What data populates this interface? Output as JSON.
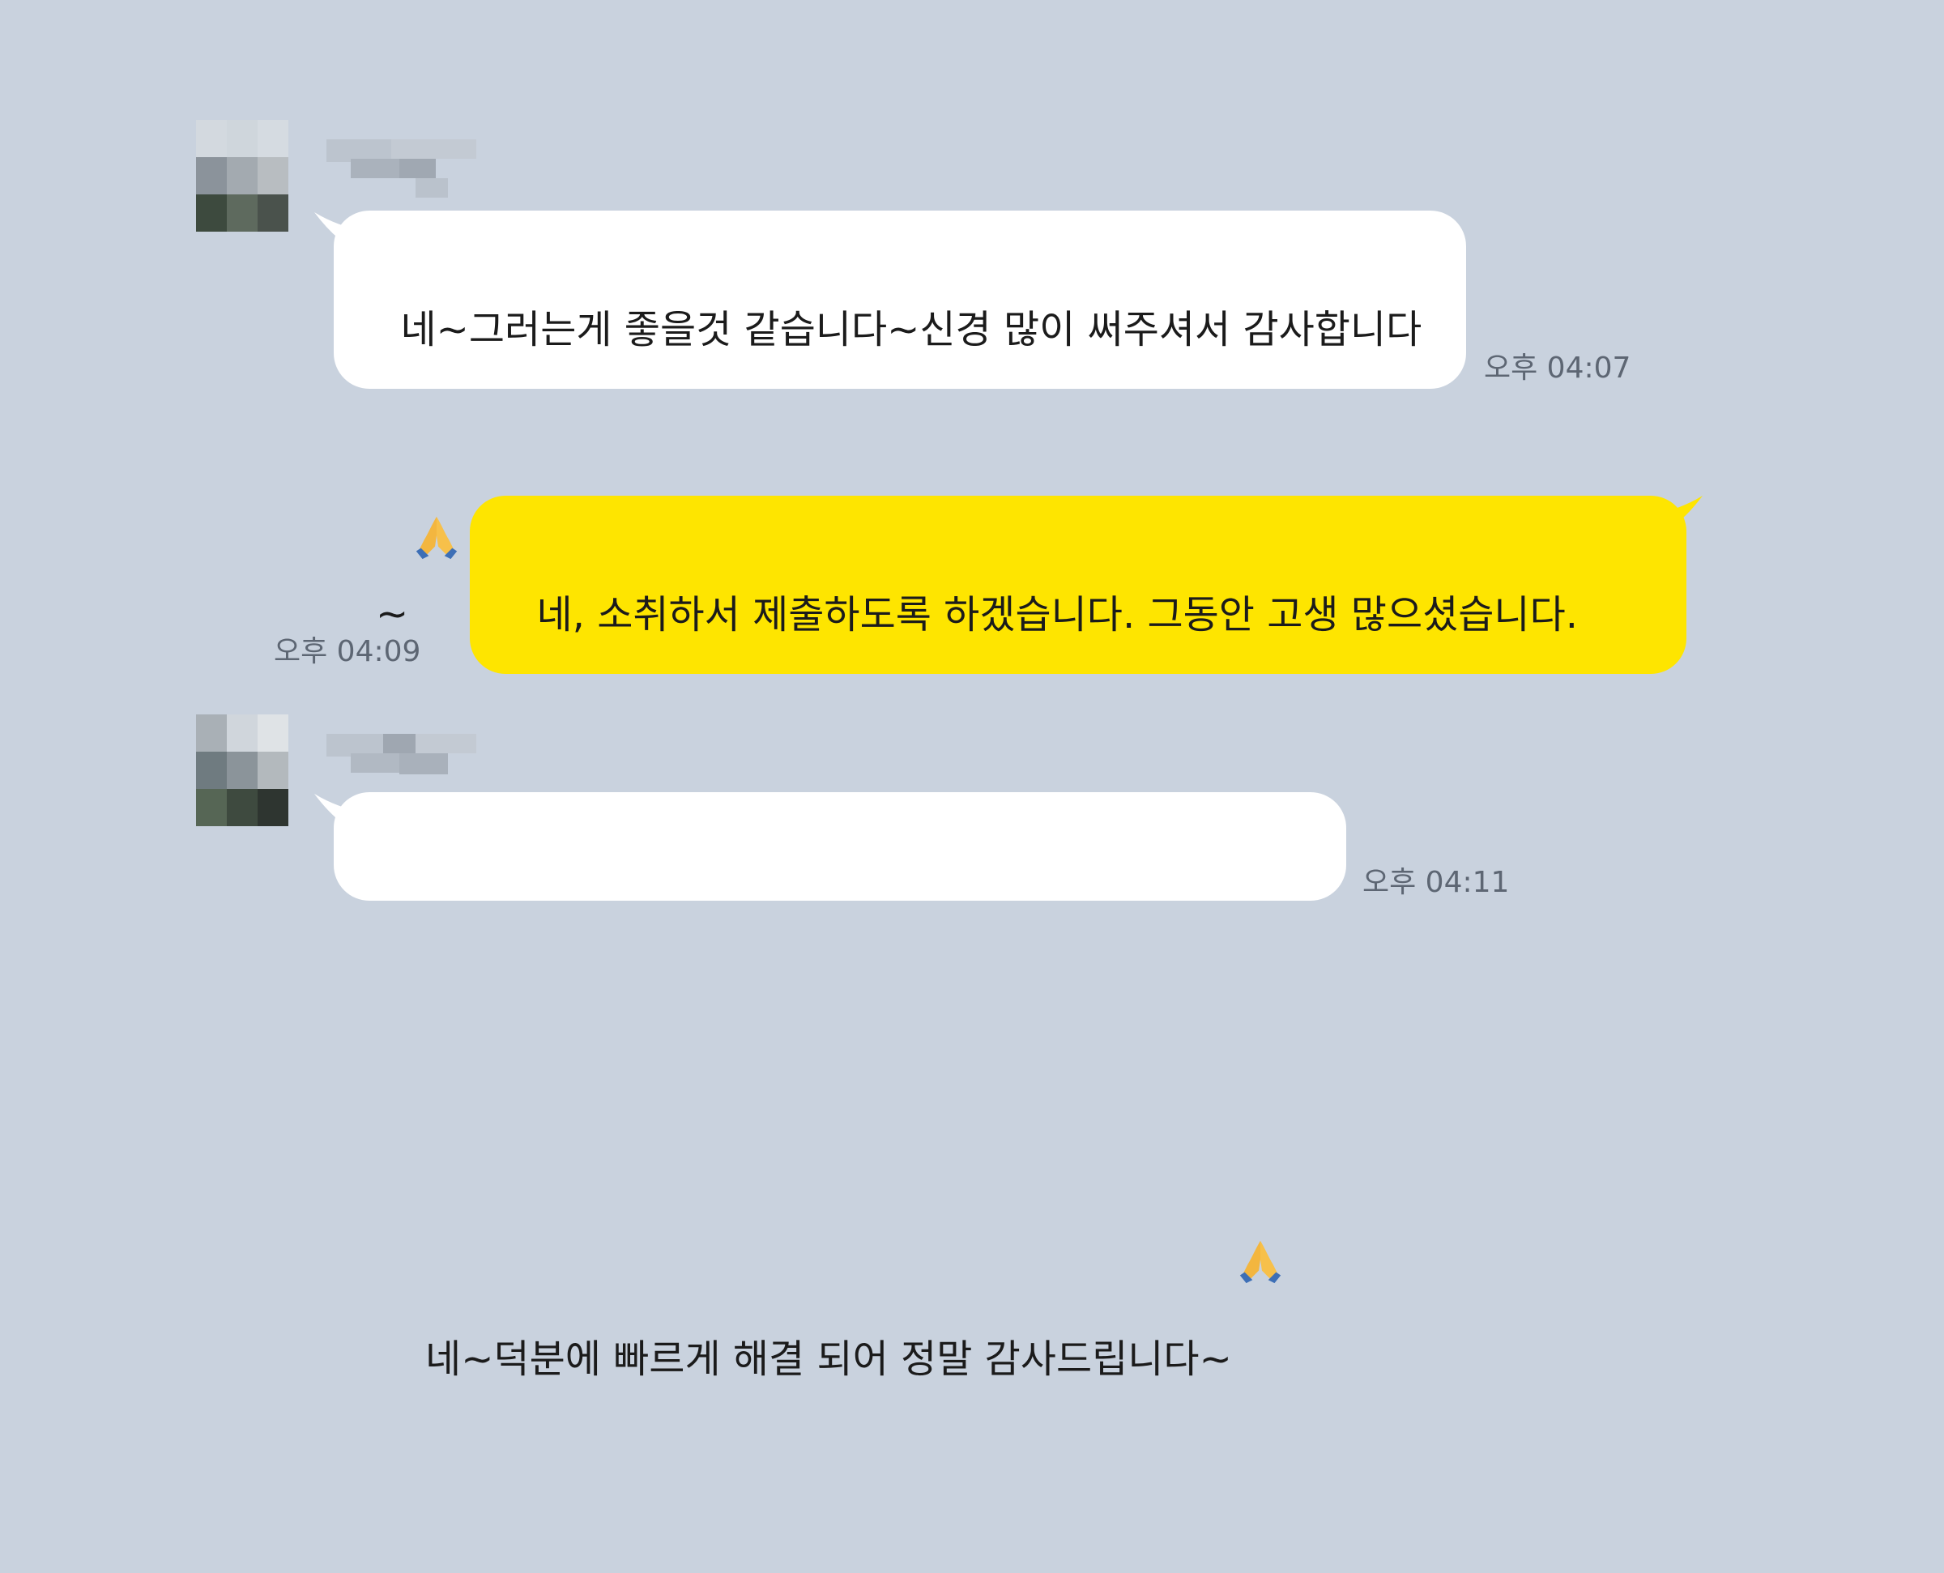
{
  "chat": {
    "messages": [
      {
        "direction": "received",
        "sender_hidden": true,
        "text": "네~그러는게 좋을것 같습니다~신경 많이 써주셔서 감사합니다~",
        "emoji": "🙏",
        "time": "오후 04:07"
      },
      {
        "direction": "sent",
        "text": "네, 소취하서 제출하도록 하겠습니다. 그동안 고생 많으셨습니다.",
        "time": "오후 04:09"
      },
      {
        "direction": "received",
        "sender_hidden": true,
        "text": "네~덕분에 빠르게 해결 되어 정말 감사드립니다~",
        "emoji": "🙏",
        "time": "오후 04:11"
      }
    ]
  },
  "colors": {
    "background": "#c9d2de",
    "received_bubble": "#ffffff",
    "sent_bubble": "#fee500",
    "time_text": "#5d6673"
  },
  "icons": {
    "avatar": "pixelated-profile-avatar",
    "name": "pixelated-sender-name",
    "emoji": "folded-hands-icon"
  }
}
